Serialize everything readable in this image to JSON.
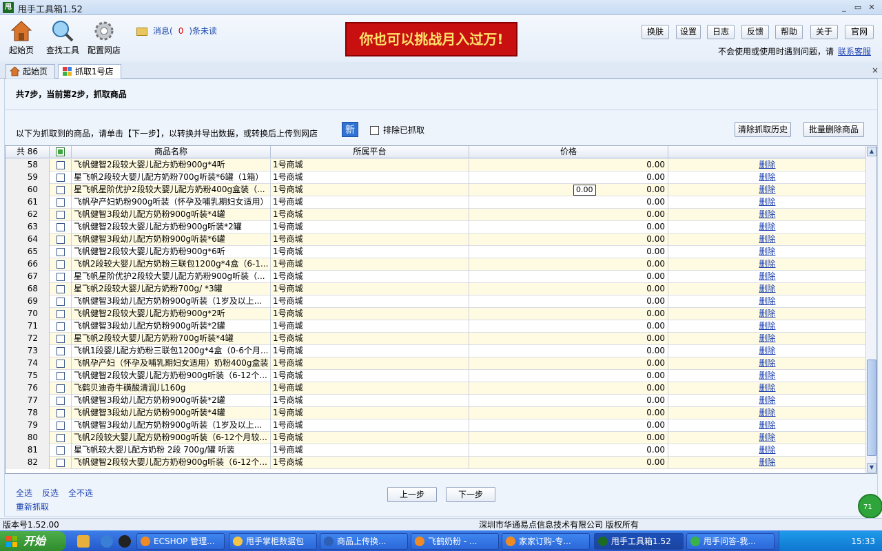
{
  "window": {
    "title": "甩手工具箱1.52",
    "min": "_",
    "max": "▭",
    "close": "✕"
  },
  "toolbar": {
    "home": "起始页",
    "find": "查找工具",
    "config": "配置网店",
    "msg_prefix": "消息(",
    "msg_count": "0",
    "msg_suffix": ")条未读",
    "banner": "你也可以挑战月入过万!",
    "buttons": [
      "换肤",
      "设置",
      "日志",
      "反馈",
      "帮助",
      "关于",
      "官网"
    ],
    "help_text": "不会使用或使用时遇到问题，请",
    "help_link": "联系客服"
  },
  "tabs": [
    {
      "label": "起始页"
    },
    {
      "label": "抓取1号店"
    }
  ],
  "tab_close": "×",
  "page": {
    "step": "共7步，当前第2步，抓取商品",
    "hint": "以下为抓取到的商品，请单击【下一步】，以转换并导出数据，或转换后上传到网店",
    "new_label": "新",
    "exclude_label": "排除已抓取",
    "clear_history": "清除抓取历史",
    "batch_delete": "批量删除商品"
  },
  "grid": {
    "count_label": "共 86",
    "headers": {
      "name": "商品名称",
      "platform": "所属平台",
      "price": "价格"
    },
    "tooltip": "0.00",
    "rows": [
      {
        "no": "58",
        "name": "飞帆健智2段较大婴儿配方奶粉900g*4听",
        "platform": "1号商城",
        "price": "0.00",
        "action": "删除"
      },
      {
        "no": "59",
        "name": "星飞帆2段较大婴儿配方奶粉700g听装*6罐（1箱）",
        "platform": "1号商城",
        "price": "0.00",
        "action": "删除"
      },
      {
        "no": "60",
        "name": "星飞帆星阶优护2段较大婴儿配方奶粉400g盒装（...",
        "platform": "1号商城",
        "price": "0.00",
        "action": "删除"
      },
      {
        "no": "61",
        "name": "飞帆孕产妇奶粉900g听装（怀孕及哺乳期妇女适用）",
        "platform": "1号商城",
        "price": "0.00",
        "action": "删除"
      },
      {
        "no": "62",
        "name": "飞帆健智3段幼儿配方奶粉900g听装*4罐",
        "platform": "1号商城",
        "price": "0.00",
        "action": "删除"
      },
      {
        "no": "63",
        "name": "飞帆健智2段较大婴儿配方奶粉900g听装*2罐",
        "platform": "1号商城",
        "price": "0.00",
        "action": "删除"
      },
      {
        "no": "64",
        "name": "飞帆健智3段幼儿配方奶粉900g听装*6罐",
        "platform": "1号商城",
        "price": "0.00",
        "action": "删除"
      },
      {
        "no": "65",
        "name": "飞帆健智2段较大婴儿配方奶粉900g*6听",
        "platform": "1号商城",
        "price": "0.00",
        "action": "删除"
      },
      {
        "no": "66",
        "name": "飞帆2段较大婴儿配方奶粉三联包1200g*4盒（6-1...",
        "platform": "1号商城",
        "price": "0.00",
        "action": "删除"
      },
      {
        "no": "67",
        "name": "星飞帆星阶优护2段较大婴儿配方奶粉900g听装（...",
        "platform": "1号商城",
        "price": "0.00",
        "action": "删除"
      },
      {
        "no": "68",
        "name": "星飞帆2段较大婴儿配方奶粉700g/ *3罐",
        "platform": "1号商城",
        "price": "0.00",
        "action": "删除"
      },
      {
        "no": "69",
        "name": "飞帆健智3段幼儿配方奶粉900g听装（1岁及以上...",
        "platform": "1号商城",
        "price": "0.00",
        "action": "删除"
      },
      {
        "no": "70",
        "name": "飞帆健智2段较大婴儿配方奶粉900g*2听",
        "platform": "1号商城",
        "price": "0.00",
        "action": "删除"
      },
      {
        "no": "71",
        "name": "飞帆健智3段幼儿配方奶粉900g听装*2罐",
        "platform": "1号商城",
        "price": "0.00",
        "action": "删除"
      },
      {
        "no": "72",
        "name": "星飞帆2段较大婴儿配方奶粉700g听装*4罐",
        "platform": "1号商城",
        "price": "0.00",
        "action": "删除"
      },
      {
        "no": "73",
        "name": "飞帆1段婴儿配方奶粉三联包1200g*4盒（0-6个月...",
        "platform": "1号商城",
        "price": "0.00",
        "action": "删除"
      },
      {
        "no": "74",
        "name": "飞帆孕产妇（怀孕及哺乳期妇女适用）奶粉400g盒装",
        "platform": "1号商城",
        "price": "0.00",
        "action": "删除"
      },
      {
        "no": "75",
        "name": "飞帆健智2段较大婴儿配方奶粉900g听装（6-12个...",
        "platform": "1号商城",
        "price": "0.00",
        "action": "删除"
      },
      {
        "no": "76",
        "name": "飞鹤贝迪奇牛磺酸清润儿160g",
        "platform": "1号商城",
        "price": "0.00",
        "action": "删除"
      },
      {
        "no": "77",
        "name": "飞帆健智3段幼儿配方奶粉900g听装*2罐",
        "platform": "1号商城",
        "price": "0.00",
        "action": "删除"
      },
      {
        "no": "78",
        "name": "飞帆健智3段幼儿配方奶粉900g听装*4罐",
        "platform": "1号商城",
        "price": "0.00",
        "action": "删除"
      },
      {
        "no": "79",
        "name": "飞帆健智3段幼儿配方奶粉900g听装（1岁及以上...",
        "platform": "1号商城",
        "price": "0.00",
        "action": "删除"
      },
      {
        "no": "80",
        "name": "飞帆2段较大婴儿配方奶粉900g听装（6-12个月较...",
        "platform": "1号商城",
        "price": "0.00",
        "action": "删除"
      },
      {
        "no": "81",
        "name": "星飞帆较大婴儿配方奶粉 2段 700g/罐 听装",
        "platform": "1号商城",
        "price": "0.00",
        "action": "删除"
      },
      {
        "no": "82",
        "name": "飞帆健智2段较大婴儿配方奶粉900g听装（6-12个...",
        "platform": "1号商城",
        "price": "0.00",
        "action": "删除"
      }
    ]
  },
  "footer": {
    "select_all": "全选",
    "invert": "反选",
    "select_none": "全不选",
    "refetch": "重新抓取",
    "prev": "上一步",
    "next": "下一步",
    "badge": "71"
  },
  "status": {
    "version": "版本号1.52.00",
    "copyright": "深圳市华通易点信息技术有限公司 版权所有"
  },
  "taskbar": {
    "start": "开始",
    "tasks": [
      "ECSHOP 管理...",
      "甩手掌柜数据包",
      "商品上传换...",
      "飞鹤奶粉 - ...",
      "家家订购-专...",
      "甩手工具箱1.52",
      "甩手问答-我..."
    ],
    "clock": "15:33"
  }
}
